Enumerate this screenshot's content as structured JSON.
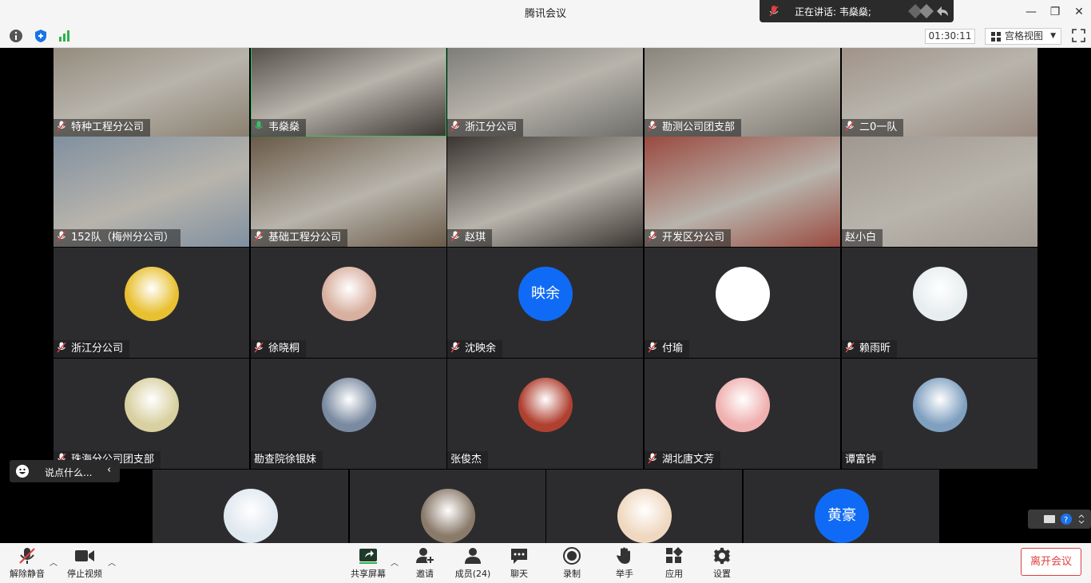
{
  "window": {
    "title": "腾讯会议"
  },
  "speaking": {
    "prefix": "正在讲话:",
    "name": "韦燊燊;"
  },
  "infobar": {
    "timer": "01:30:11",
    "view_label": "宫格视图"
  },
  "participants": [
    {
      "name": "特种工程分公司",
      "mic": "muted",
      "type": "video",
      "bg": "#8a8070"
    },
    {
      "name": "韦燊燊",
      "mic": "active",
      "type": "video",
      "bg": "#3a3530"
    },
    {
      "name": "浙江分公司",
      "mic": "muted",
      "type": "video",
      "bg": "#6e6e6a"
    },
    {
      "name": "勘测公司团支部",
      "mic": "muted",
      "type": "video",
      "bg": "#7c7870"
    },
    {
      "name": "二0一队",
      "mic": "muted",
      "type": "video",
      "bg": "#9a8a80"
    },
    {
      "name": "152队（梅州分公司）",
      "mic": "muted",
      "type": "video",
      "bg": "#8090a0"
    },
    {
      "name": "基础工程分公司",
      "mic": "muted",
      "type": "video",
      "bg": "#6a5a48"
    },
    {
      "name": "赵琪",
      "mic": "muted",
      "type": "video",
      "bg": "#3a3530"
    },
    {
      "name": "开发区分公司",
      "mic": "muted",
      "type": "video",
      "bg": "#9a4a40"
    },
    {
      "name": "赵小白",
      "mic": "none",
      "type": "video",
      "bg": "#a09890"
    },
    {
      "name": "浙江分公司",
      "mic": "muted",
      "type": "avatar",
      "avatar_color": "#e8c030"
    },
    {
      "name": "徐晓桐",
      "mic": "muted",
      "type": "avatar",
      "avatar_color": "#d8b0a0"
    },
    {
      "name": "沈映余",
      "mic": "muted",
      "type": "avatar-text",
      "avatar_text": "映余"
    },
    {
      "name": "付瑜",
      "mic": "muted",
      "type": "avatar",
      "avatar_color": "#ffffff"
    },
    {
      "name": "赖雨昕",
      "mic": "muted",
      "type": "avatar",
      "avatar_color": "#e8eef0"
    },
    {
      "name": "珠海分公司团支部",
      "mic": "muted",
      "type": "avatar",
      "avatar_color": "#d8d0a0"
    },
    {
      "name": "勘查院徐银妹",
      "mic": "none",
      "type": "avatar",
      "avatar_color": "#7a8aa0"
    },
    {
      "name": "张俊杰",
      "mic": "none",
      "type": "avatar",
      "avatar_color": "#b04030"
    },
    {
      "name": "湖北唐文芳",
      "mic": "muted",
      "type": "avatar",
      "avatar_color": "#f0b0b0"
    },
    {
      "name": "谭富钟",
      "mic": "none",
      "type": "avatar",
      "avatar_color": "#80a0c0"
    },
    {
      "name": "",
      "mic": "none",
      "type": "avatar",
      "avatar_color": "#e0e8f0"
    },
    {
      "name": "",
      "mic": "none",
      "type": "avatar",
      "avatar_color": "#8a7a6a"
    },
    {
      "name": "",
      "mic": "none",
      "type": "avatar",
      "avatar_color": "#f0d8c0"
    },
    {
      "name": "",
      "mic": "none",
      "type": "avatar-text",
      "avatar_text": "黄豪"
    }
  ],
  "chat": {
    "placeholder": "说点什么..."
  },
  "toolbar": {
    "unmute": "解除静音",
    "stop_video": "停止视频",
    "share": "共享屏幕",
    "invite": "邀请",
    "members": "成员(24)",
    "chat": "聊天",
    "record": "录制",
    "raise_hand": "举手",
    "apps": "应用",
    "settings": "设置",
    "leave": "离开会议"
  },
  "colors": {
    "accent": "#0f6bf5",
    "active_speaker": "#39c16a",
    "leave": "#e04040"
  }
}
